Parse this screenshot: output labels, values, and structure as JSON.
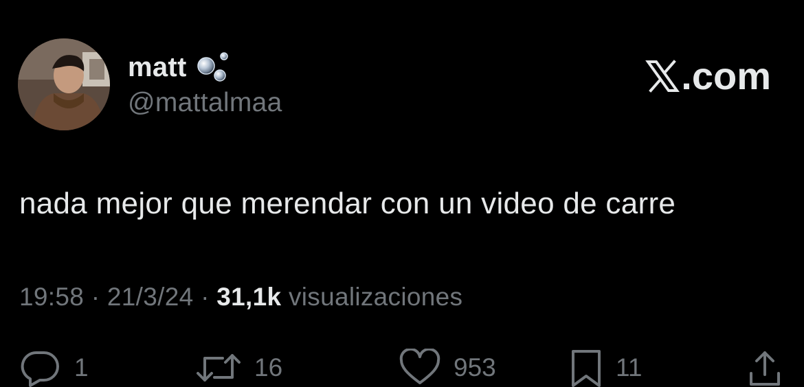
{
  "tweet": {
    "display_name": "matt",
    "handle": "@mattalmaa",
    "text": "nada mejor que merendar con un video de carre",
    "time": "19:58",
    "date": "21/3/24",
    "separator": "·",
    "views_count": "31,1k",
    "views_label": "visualizaciones"
  },
  "brand": {
    "suffix": ".com",
    "icon": "x-logo-icon"
  },
  "actions": {
    "reply": {
      "icon": "reply-icon",
      "count": "1"
    },
    "retweet": {
      "icon": "retweet-icon",
      "count": "16"
    },
    "like": {
      "icon": "heart-icon",
      "count": "953"
    },
    "bookmark": {
      "icon": "bookmark-icon",
      "count": "11"
    },
    "share": {
      "icon": "share-icon"
    }
  },
  "colors": {
    "background": "#000000",
    "primary_text": "#e7e9ea",
    "secondary_text": "#71767b"
  }
}
